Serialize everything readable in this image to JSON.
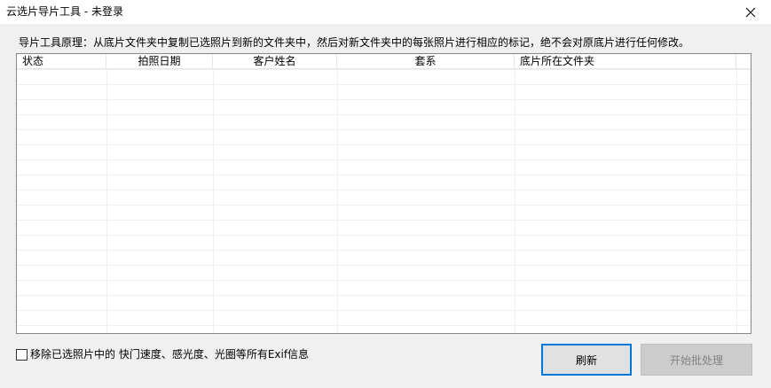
{
  "window": {
    "title": "云选片导片工具 - 未登录"
  },
  "intro_text": "导片工具原理：从底片文件夹中复制已选照片到新的文件夹中，然后对新文件夹中的每张照片进行相应的标记，绝不会对原底片进行任何修改。",
  "table": {
    "columns": [
      "状态",
      "拍照日期",
      "客户姓名",
      "套系",
      "底片所在文件夹"
    ],
    "rows": []
  },
  "options": {
    "strip_exif_label": "移除已选照片中的 快门速度、感光度、光圈等所有Exif信息",
    "strip_exif_checked": false
  },
  "buttons": {
    "refresh": "刷新",
    "start": "开始批处理",
    "start_enabled": false
  },
  "colors": {
    "accent": "#0078d7",
    "window_bg": "#f0f0f0",
    "disabled_button_bg": "#cccccc",
    "disabled_text": "#838383"
  },
  "icons": {
    "close": "close-icon"
  }
}
